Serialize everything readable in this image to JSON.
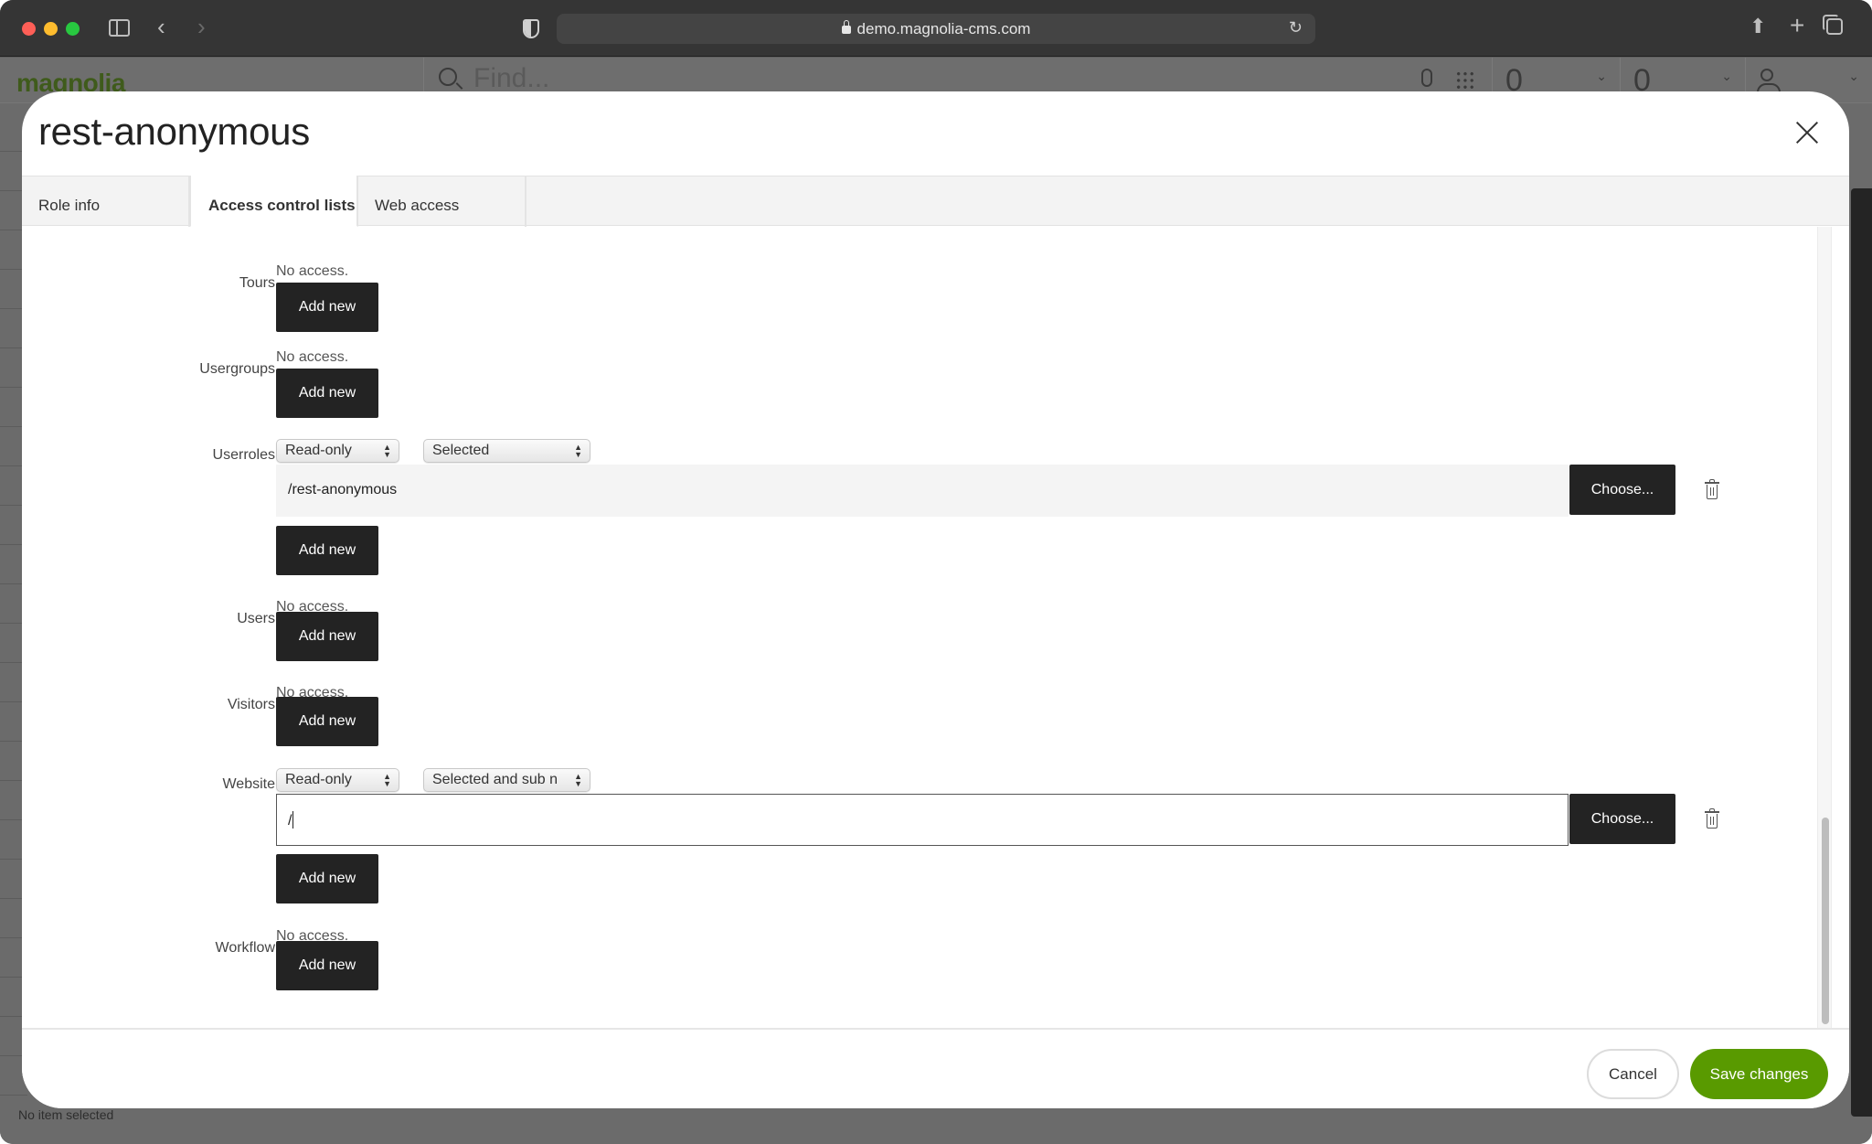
{
  "browser": {
    "url": "demo.magnolia-cms.com",
    "icons": [
      "close-window",
      "minimize-window",
      "zoom-window",
      "sidebar-icon",
      "back-icon",
      "forward-icon",
      "privacy-shield-icon",
      "lock-icon",
      "reload-icon",
      "share-icon",
      "new-tab-icon",
      "tab-overview-icon"
    ]
  },
  "app": {
    "logo": "magnolia",
    "search_placeholder": "Find...",
    "counter1": "0",
    "counter2": "0",
    "status": "No item selected"
  },
  "modal": {
    "title": "rest-anonymous",
    "tabs": [
      {
        "label": "Role info",
        "active": false
      },
      {
        "label": "Access control lists",
        "active": true
      },
      {
        "label": "Web access",
        "active": false
      }
    ],
    "no_access_text": "No access.",
    "add_new_label": "Add new",
    "choose_label": "Choose...",
    "rows": {
      "tours": {
        "label": "Tours"
      },
      "usergroups": {
        "label": "Usergroups"
      },
      "userroles": {
        "label": "Userroles",
        "permission": "Read-only",
        "scope": "Selected",
        "path": "/rest-anonymous"
      },
      "users": {
        "label": "Users"
      },
      "visitors": {
        "label": "Visitors"
      },
      "website": {
        "label": "Website",
        "permission": "Read-only",
        "scope": "Selected and sub n",
        "path": "/"
      },
      "workflow": {
        "label": "Workflow"
      }
    },
    "scroll_position_fraction": 0.74,
    "footer": {
      "cancel_label": "Cancel",
      "save_label": "Save changes",
      "save_color": "#599a00"
    }
  }
}
